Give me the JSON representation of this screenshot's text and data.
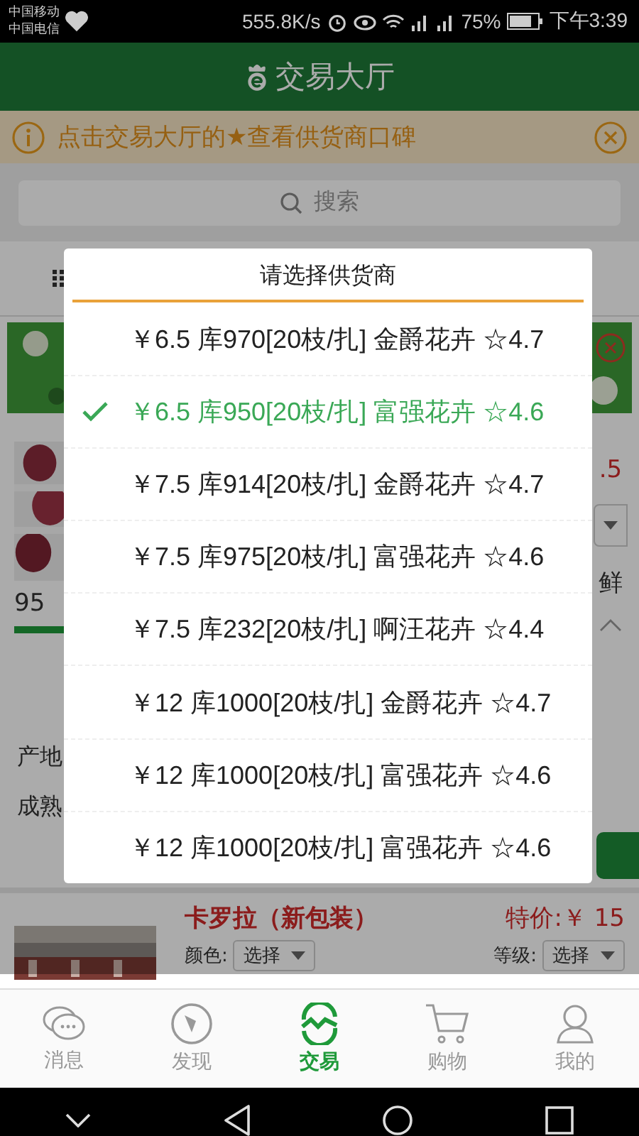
{
  "status_bar": {
    "carriers": [
      "中国移动",
      "中国电信"
    ],
    "speed": "555.8K/s",
    "battery": "75%",
    "time": "下午3:39"
  },
  "header": {
    "title": "交易大厅"
  },
  "notice": {
    "text": "点击交易大厅的★查看供货商口碑"
  },
  "search": {
    "placeholder": "搜索"
  },
  "product_1": {
    "count_fragment": "95",
    "price_fragment": ".5",
    "name_fragment": "鲜",
    "labels": [
      "产地",
      "成熟"
    ]
  },
  "product_2": {
    "name": "卡罗拉（新包装）",
    "price": "特价:￥ 15",
    "color_label": "颜色:",
    "color_value": "选择",
    "grade_label": "等级:",
    "grade_value": "选择"
  },
  "dialog": {
    "title": "请选择供货商",
    "options": [
      {
        "text": "￥6.5 库970[20枝/扎] 金爵花卉 ☆4.7",
        "selected": false
      },
      {
        "text": "￥6.5 库950[20枝/扎] 富强花卉 ☆4.6",
        "selected": true
      },
      {
        "text": "￥7.5 库914[20枝/扎] 金爵花卉 ☆4.7",
        "selected": false
      },
      {
        "text": "￥7.5 库975[20枝/扎] 富强花卉 ☆4.6",
        "selected": false
      },
      {
        "text": "￥7.5 库232[20枝/扎] 啊汪花卉 ☆4.4",
        "selected": false
      },
      {
        "text": "￥12 库1000[20枝/扎] 金爵花卉 ☆4.7",
        "selected": false
      },
      {
        "text": "￥12 库1000[20枝/扎] 富强花卉 ☆4.6",
        "selected": false
      },
      {
        "text": "￥12 库1000[20枝/扎] 富强花卉 ☆4.6",
        "selected": false
      }
    ]
  },
  "tabs": [
    {
      "label": "消息",
      "kind": "chat",
      "selected": false
    },
    {
      "label": "发现",
      "kind": "compass",
      "selected": false
    },
    {
      "label": "交易",
      "kind": "trade",
      "selected": true
    },
    {
      "label": "购物",
      "kind": "cart",
      "selected": false
    },
    {
      "label": "我的",
      "kind": "person",
      "selected": false
    }
  ]
}
